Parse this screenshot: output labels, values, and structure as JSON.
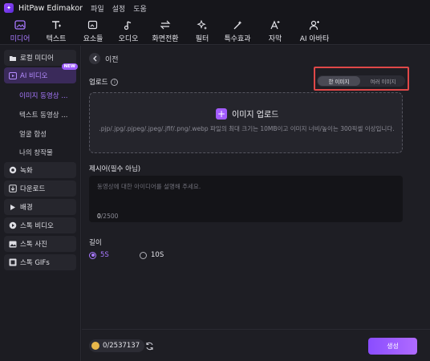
{
  "app": {
    "title": "HitPaw Edimakor",
    "menu": [
      "파일",
      "설정",
      "도움"
    ]
  },
  "toolbar": {
    "tools": [
      {
        "label": "미디어",
        "icon": "media-icon",
        "active": true
      },
      {
        "label": "텍스트",
        "icon": "text-icon"
      },
      {
        "label": "요소들",
        "icon": "elements-icon"
      },
      {
        "label": "오디오",
        "icon": "audio-icon"
      },
      {
        "label": "화면전환",
        "icon": "transition-icon"
      },
      {
        "label": "필터",
        "icon": "filter-icon"
      },
      {
        "label": "특수효과",
        "icon": "effects-icon"
      },
      {
        "label": "자막",
        "icon": "subtitle-icon"
      },
      {
        "label": "AI 아바타",
        "icon": "ai-avatar-icon"
      }
    ]
  },
  "sidebar": {
    "groups": [
      {
        "label": "로컬 미디어",
        "icon": "folder-icon"
      },
      {
        "label": "AI 비디오",
        "icon": "ai-video-icon",
        "badge": "NEW",
        "active": true
      },
      {
        "label": "녹화",
        "icon": "record-icon"
      },
      {
        "label": "다운로드",
        "icon": "download-icon"
      },
      {
        "label": "배경",
        "icon": "triangle-right-icon"
      },
      {
        "label": "스톡 비디오",
        "icon": "stock-video-icon"
      },
      {
        "label": "스톡 사진",
        "icon": "stock-photo-icon"
      },
      {
        "label": "스톡 GIFs",
        "icon": "stock-gif-icon"
      }
    ],
    "sub_items": [
      "이미지 동영상 ...",
      "텍스트 동영상 ...",
      "얼굴 합성",
      "나의 창작물"
    ]
  },
  "main": {
    "back_label": "이전",
    "upload_title": "업로드",
    "mode_options": [
      "한 이미지",
      "여러 이미지"
    ],
    "upload_button": "이미지 업로드",
    "upload_hint": ".pjp/.jpg/.pjpeg/.jpeg/.jfif/.png/.webp 파일의 최대 크기는 10MB이고 이미지 너비/높이는 300픽셀 이상입니다.",
    "prompt_title": "제시어(필수 아님)",
    "prompt_placeholder": "동영상에 대한 아이디어를 설명해 주세요.",
    "prompt_count": "0",
    "prompt_max": "/2500",
    "length_title": "길이",
    "length_options": [
      "5S",
      "10S"
    ],
    "credits": "0/2537137",
    "generate_button": "생성"
  },
  "colors": {
    "accent": "#a879ff",
    "highlight": "#e04848",
    "coin": "#e8b74a"
  }
}
